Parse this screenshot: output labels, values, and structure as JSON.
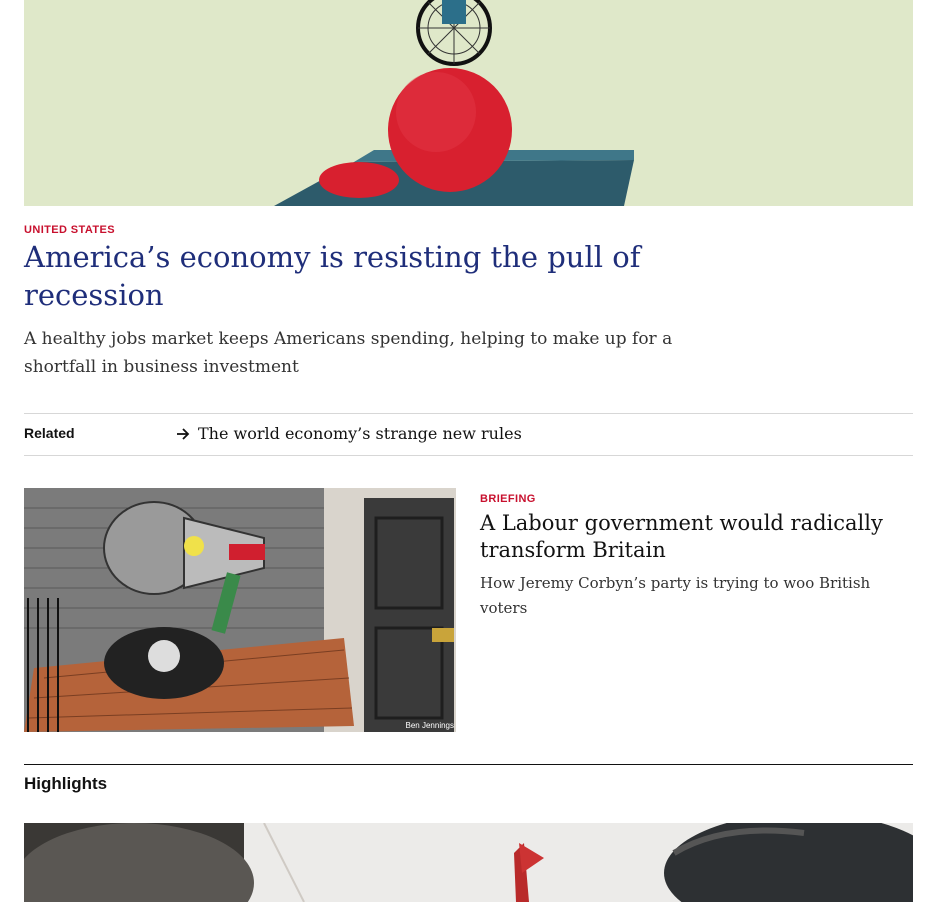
{
  "colors": {
    "kicker_red": "#c8102e",
    "headline_blue": "#1f2e7a",
    "text_dark": "#121212",
    "rule_grey": "#d7d7d7"
  },
  "lead_story": {
    "image_alt": "Illustration of a unicycle balancing on a red ball over a seesaw",
    "kicker": "United States",
    "title": "America’s economy is resisting the pull of recession",
    "description": "A healthy jobs market keeps Americans spending, helping to make up for a shortfall in business investment"
  },
  "related": {
    "label": "Related",
    "icon": "arrow-right-icon",
    "link_text": "The world economy’s strange new rules"
  },
  "second_story": {
    "image_alt": "Illustration of a megaphone on a lectern outside a door",
    "image_credit": "Ben Jennings",
    "kicker": "Briefing",
    "title": "A Labour government would radically transform Britain",
    "description": "How Jeremy Corbyn’s party is trying to woo British voters"
  },
  "highlights": {
    "title": "Highlights",
    "image_alt": "Photo with a red flag"
  }
}
